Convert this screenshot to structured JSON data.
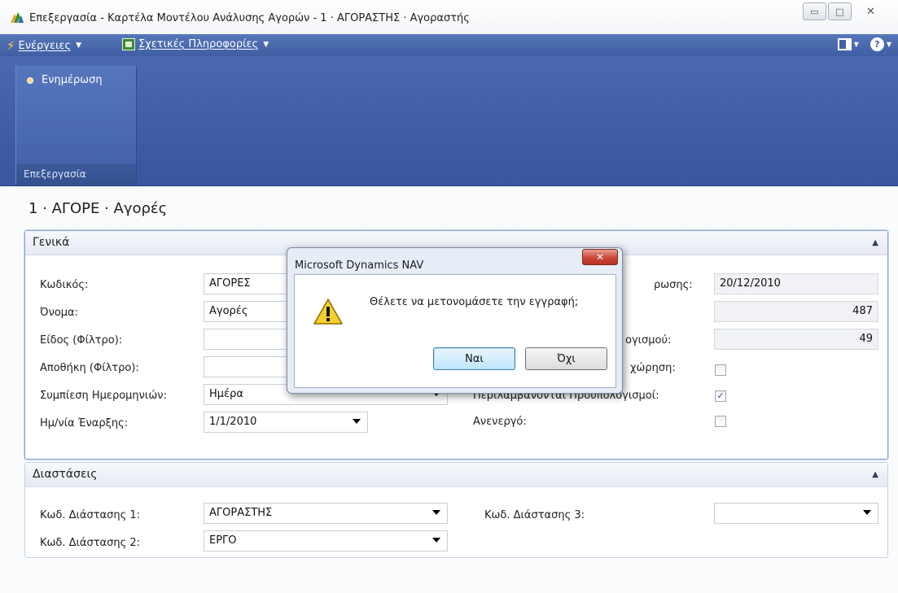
{
  "window": {
    "title": "Επεξεργασία - Καρτέλα Μοντέλου Ανάλυσης Αγορών - 1 · ΑΓΟΡΑΣΤΗΣ · Αγοραστής",
    "minimize": "▭",
    "maximize": "□",
    "close": "✕"
  },
  "menubar": {
    "actions_label": "Ενέργειες",
    "related_label": "Σχετικές Πληροφορίες",
    "help": "?"
  },
  "ribbon": {
    "update_label": "Ενημέρωση",
    "group_label": "Επεξεργασία"
  },
  "page": {
    "title": "1 · ΑΓΟΡΕ · Αγορές"
  },
  "general": {
    "header": "Γενικά",
    "code_label": "Κωδικός:",
    "code_value": "ΑΓΟΡΕΣ",
    "name_label": "Όνομα:",
    "name_value": "Αγορές",
    "item_filter_label": "Είδος (Φίλτρο):",
    "item_filter_value": "",
    "location_filter_label": "Αποθήκη (Φίλτρο):",
    "location_filter_value": "",
    "date_compression_label": "Συμπίεση Ημερομηνιών:",
    "date_compression_value": "Ημέρα",
    "start_date_label": "Ημ/νία Έναρξης:",
    "start_date_value": "1/1/2010",
    "last_updated_label": "ρωσης:",
    "last_updated_value": "20/12/2010",
    "value_1": "487",
    "budget_label": "ογισμού:",
    "value_2": "49",
    "entry_label": "χώρηση:",
    "include_budgets_label": "Περιλαμβάνονται Προϋπολογισμοί:",
    "include_budgets_checked": true,
    "blocked_label": "Ανενεργό:",
    "blocked_checked": false,
    "entry_checked": false
  },
  "dimensions": {
    "header": "Διαστάσεις",
    "dim1_label": "Κωδ. Διάστασης 1:",
    "dim1_value": "ΑΓΟΡΑΣΤΗΣ",
    "dim2_label": "Κωδ. Διάστασης 2:",
    "dim2_value": "ΕΡΓΟ",
    "dim3_label": "Κωδ. Διάστασης 3:",
    "dim3_value": ""
  },
  "dialog": {
    "title": "Microsoft Dynamics NAV",
    "message": "Θέλετε να μετονομάσετε την εγγραφή;",
    "yes_label": "Ναι",
    "no_label": "Όχι",
    "close": "✕"
  },
  "colors": {
    "menubar": "#4a69ae",
    "ribbon": "#3f5ea3",
    "fasttab_border": "#86a3d0",
    "checkbox_mark": "#2b55a8"
  }
}
